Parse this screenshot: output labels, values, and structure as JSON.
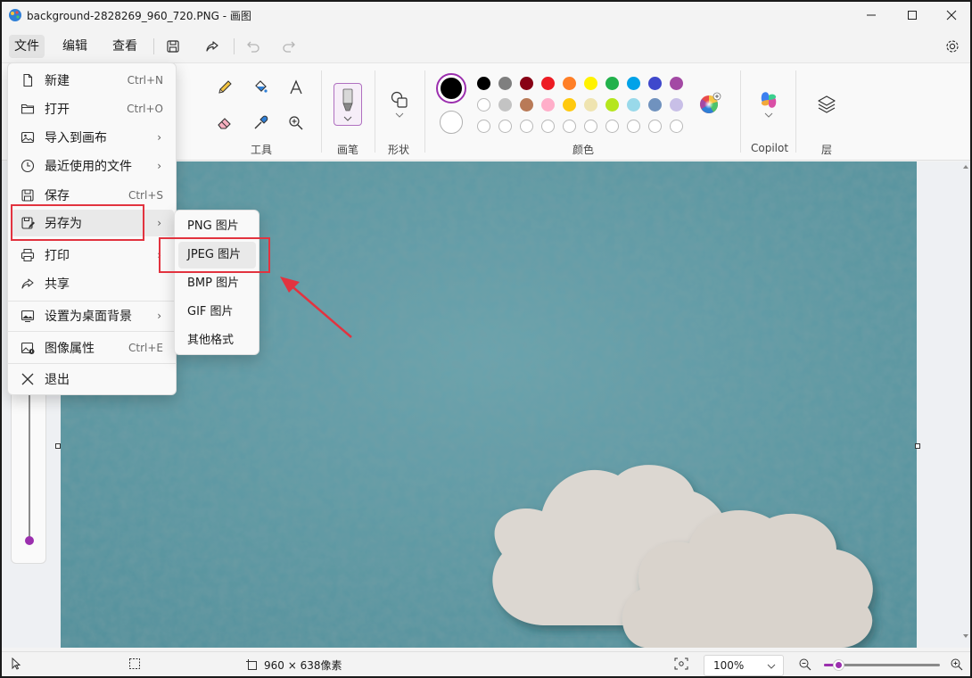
{
  "window": {
    "title": "background-2828269_960_720.PNG - 画图"
  },
  "menubar": {
    "tabs": [
      "文件",
      "编辑",
      "查看"
    ]
  },
  "ribbon": {
    "groups": {
      "tools": "工具",
      "brushes": "画笔",
      "shapes": "形状",
      "colors": "颜色",
      "copilot": "Copilot",
      "layers": "层"
    },
    "palette_row1": [
      "#000000",
      "#7f7f7f",
      "#880015",
      "#ed1c24",
      "#ff7f27",
      "#fff200",
      "#22b14c",
      "#00a2e8",
      "#3f48cc",
      "#a349a4"
    ],
    "palette_row2": [
      "#ffffff",
      "#c3c3c3",
      "#b97a57",
      "#ffaec9",
      "#ffc90e",
      "#efe4b0",
      "#b5e61d",
      "#99d9ea",
      "#7092be",
      "#c8bfe7"
    ],
    "primary_color": "#000000",
    "secondary_color": "#ffffff"
  },
  "file_menu": {
    "items": [
      {
        "label": "新建",
        "shortcut": "Ctrl+N",
        "icon": "new-file-icon"
      },
      {
        "label": "打开",
        "shortcut": "Ctrl+O",
        "icon": "folder-icon"
      },
      {
        "label": "导入到画布",
        "shortcut": "",
        "icon": "import-image-icon"
      },
      {
        "label": "最近使用的文件",
        "shortcut": "",
        "icon": "clock-icon"
      },
      {
        "label": "保存",
        "shortcut": "Ctrl+S",
        "icon": "save-icon"
      },
      {
        "label": "另存为",
        "shortcut": "",
        "icon": "save-as-icon"
      },
      {
        "label": "打印",
        "shortcut": "",
        "icon": "printer-icon"
      },
      {
        "label": "共享",
        "shortcut": "",
        "icon": "share-icon"
      },
      {
        "label": "设置为桌面背景",
        "shortcut": "",
        "icon": "desktop-background-icon"
      },
      {
        "label": "图像属性",
        "shortcut": "Ctrl+E",
        "icon": "image-properties-icon"
      },
      {
        "label": "退出",
        "shortcut": "",
        "icon": "close-icon"
      }
    ],
    "arrow": "›"
  },
  "save_as_menu": {
    "items": [
      "PNG 图片",
      "JPEG 图片",
      "BMP 图片",
      "GIF 图片",
      "其他格式"
    ]
  },
  "statusbar": {
    "canvas_size": "960 × 638像素",
    "zoom": "100%",
    "zoom_level": 0.12
  },
  "colors": {
    "accent": "#9b2fae",
    "highlight": "#e2333f",
    "canvas_bg": "#5f98a3"
  }
}
